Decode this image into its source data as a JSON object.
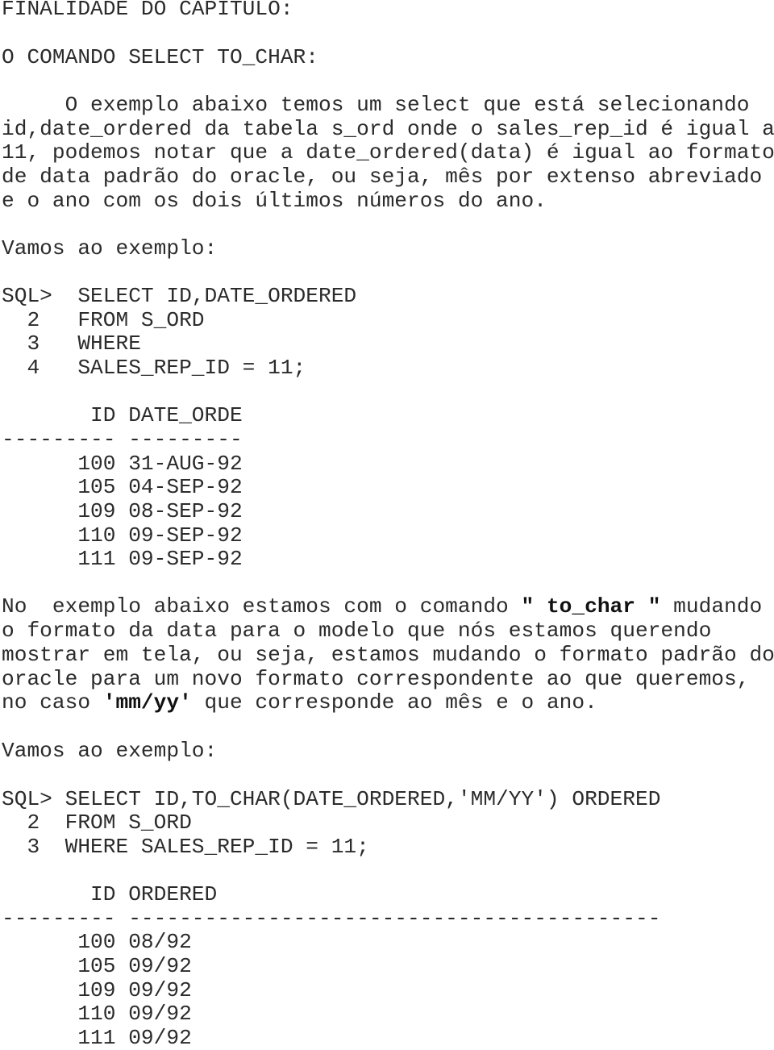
{
  "document": {
    "heading": "FINALIDADE DO CAPITULO:",
    "subheading": "O COMANDO SELECT TO_CHAR:",
    "intro_paragraph": [
      "     O exemplo abaixo temos um select que está selecionando",
      "id,date_ordered da tabela s_ord onde o sales_rep_id é igual a",
      "11, podemos notar que a date_ordered(data) é igual ao formato",
      "de data padrão do oracle, ou seja, mês por extenso abreviado",
      "e o ano com os dois últimos números do ano."
    ],
    "example_label_1": "Vamos ao exemplo:",
    "query_1": [
      "SQL>  SELECT ID,DATE_ORDERED",
      "  2   FROM S_ORD",
      "  3   WHERE",
      "  4   SALES_REP_ID = 11;"
    ],
    "result_1": {
      "header": "       ID DATE_ORDE",
      "separator": "--------- ---------",
      "rows": [
        "      100 31-AUG-92",
        "      105 04-SEP-92",
        "      109 08-SEP-92",
        "      110 09-SEP-92",
        "      111 09-SEP-92"
      ],
      "columns": [
        "ID",
        "DATE_ORDE"
      ],
      "data": [
        {
          "id": "100",
          "date_ordered": "31-AUG-92"
        },
        {
          "id": "105",
          "date_ordered": "04-SEP-92"
        },
        {
          "id": "109",
          "date_ordered": "08-SEP-92"
        },
        {
          "id": "110",
          "date_ordered": "09-SEP-92"
        },
        {
          "id": "111",
          "date_ordered": "09-SEP-92"
        }
      ]
    },
    "second_paragraph": {
      "line1_pre": "No  exemplo abaixo estamos com o comando ",
      "line1_bold": "\" to_char \"",
      "line1_post": " mudando",
      "line2": "o formato da data para o modelo que nós estamos querendo",
      "line3": "mostrar em tela, ou seja, estamos mudando o formato padrão do",
      "line4": "oracle para um novo formato correspondente ao que queremos,",
      "line5_pre": "no caso ",
      "line5_bold": "'mm/yy'",
      "line5_post": " que corresponde ao mês e o ano."
    },
    "example_label_2": "Vamos ao exemplo:",
    "query_2": [
      "SQL> SELECT ID,TO_CHAR(DATE_ORDERED,'MM/YY') ORDERED",
      "  2  FROM S_ORD",
      "  3  WHERE SALES_REP_ID = 11;"
    ],
    "result_2": {
      "header": "       ID ORDERED",
      "separator": "--------- ------------------------------------------",
      "rows": [
        "      100 08/92",
        "      105 09/92",
        "      109 09/92",
        "      110 09/92",
        "      111 09/92"
      ],
      "columns": [
        "ID",
        "ORDERED"
      ],
      "data": [
        {
          "id": "100",
          "ordered": "08/92"
        },
        {
          "id": "105",
          "ordered": "09/92"
        },
        {
          "id": "109",
          "ordered": "09/92"
        },
        {
          "id": "110",
          "ordered": "09/92"
        },
        {
          "id": "111",
          "ordered": "09/92"
        }
      ]
    }
  }
}
